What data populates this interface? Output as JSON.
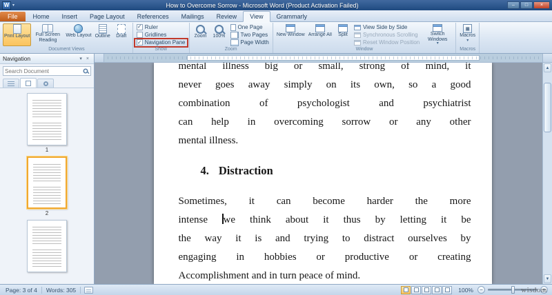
{
  "icons": {
    "app_letter": "W",
    "caret_down": "▾",
    "minimize": "–",
    "maximize": "□",
    "close": "×",
    "check": "✓",
    "scroll_up": "▲",
    "scroll_down": "▼",
    "zoom_out": "−",
    "zoom_in": "+",
    "macro_glyph": "▦"
  },
  "window": {
    "title": "How to Overcome Sorrow  -  Microsoft Word (Product Activation Failed)"
  },
  "tabs": [
    {
      "label": "File"
    },
    {
      "label": "Home"
    },
    {
      "label": "Insert"
    },
    {
      "label": "Page Layout"
    },
    {
      "label": "References"
    },
    {
      "label": "Mailings"
    },
    {
      "label": "Review"
    },
    {
      "label": "View"
    },
    {
      "label": "Grammarly"
    }
  ],
  "ribbon": {
    "document_views": {
      "label": "Document Views",
      "print_layout": "Print Layout",
      "full_screen_reading": "Full Screen Reading",
      "web_layout": "Web Layout",
      "outline": "Outline",
      "draft": "Draft"
    },
    "show": {
      "label": "Show",
      "ruler": "Ruler",
      "gridlines": "Gridlines",
      "navigation_pane": "Navigation Pane"
    },
    "zoom": {
      "label": "Zoom",
      "zoom": "Zoom",
      "hundred": "100%",
      "one_page": "One Page",
      "two_pages": "Two Pages",
      "page_width": "Page Width"
    },
    "window": {
      "label": "Window",
      "new_window": "New Window",
      "arrange_all": "Arrange All",
      "split": "Split",
      "side_by_side": "View Side by Side",
      "sync_scrolling": "Synchronous Scrolling",
      "reset_position": "Reset Window Position",
      "switch_windows": "Switch Windows"
    },
    "macros": {
      "label": "Macros",
      "macros": "Macros"
    }
  },
  "navigation_pane": {
    "title": "Navigation",
    "search_placeholder": "Search Document",
    "thumbnails": [
      {
        "page": "1"
      },
      {
        "page": "2"
      }
    ]
  },
  "document": {
    "para1_lines": [
      "mental illness big or small, strong of mind, it",
      "never goes away simply on its own, so a good",
      "combination of psychologist and psychiatrist",
      "can help in overcoming sorrow or any other",
      "mental illness."
    ],
    "heading_number": "4.",
    "heading_text": "Distraction",
    "para2_line1": "Sometimes,  it can become harder the more",
    "para2_line2_before": "intense ",
    "para2_line2_after": "we think about it thus by letting it be",
    "para2_line3": "the way it is and trying to distract ourselves by",
    "para2_line4": "engaging in hobbies or productive or creating",
    "para2_line5": "Accomplishment and in turn peace of mind."
  },
  "status_bar": {
    "page": "Page: 3 of 4",
    "words": "Words: 305",
    "zoom_percent": "100%"
  },
  "watermark": "wisdom"
}
